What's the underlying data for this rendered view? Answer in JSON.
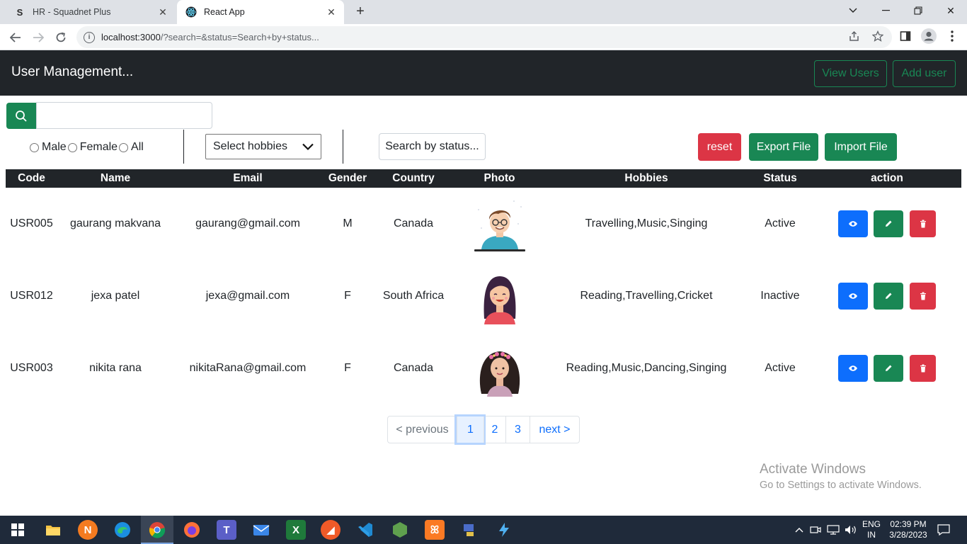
{
  "browser": {
    "tabs": [
      {
        "title": "HR - Squadnet Plus",
        "favicon": "S"
      },
      {
        "title": "React App",
        "favicon": "react-icon"
      }
    ],
    "url_main": "localhost:3000",
    "url_rest": "/?search=&status=Search+by+status..."
  },
  "app": {
    "brand": "User Management...",
    "nav": {
      "view_users": "View Users",
      "add_user": "Add user"
    }
  },
  "filters": {
    "search_value": "",
    "gender_options": [
      "Male",
      "Female",
      "All"
    ],
    "hobbies_select": "Select hobbies",
    "status_placeholder": "Search by status...",
    "reset": "reset",
    "export": "Export File",
    "import": "Import File"
  },
  "table": {
    "headers": [
      "Code",
      "Name",
      "Email",
      "Gender",
      "Country",
      "Photo",
      "Hobbies",
      "Status",
      "action"
    ],
    "rows": [
      {
        "code": "USR005",
        "name": "gaurang makvana",
        "email": "gaurang@gmail.com",
        "gender": "M",
        "country": "Canada",
        "hobbies": "Travelling,Music,Singing",
        "status": "Active"
      },
      {
        "code": "USR012",
        "name": "jexa patel",
        "email": "jexa@gmail.com",
        "gender": "F",
        "country": "South Africa",
        "hobbies": "Reading,Travelling,Cricket",
        "status": "Inactive"
      },
      {
        "code": "USR003",
        "name": "nikita rana",
        "email": "nikitaRana@gmail.com",
        "gender": "F",
        "country": "Canada",
        "hobbies": "Reading,Music,Dancing,Singing",
        "status": "Active"
      }
    ]
  },
  "pagination": {
    "previous": "< previous",
    "pages": [
      "1",
      "2",
      "3"
    ],
    "next": "next >",
    "current": "1"
  },
  "watermark": {
    "line1": "Activate Windows",
    "line2": "Go to Settings to activate Windows."
  },
  "taskbar": {
    "lang1": "ENG",
    "lang2": "IN",
    "time": "02:39 PM",
    "date": "3/28/2023"
  },
  "colors": {
    "primary": "#0d6efd",
    "success": "#198754",
    "danger": "#dc3545",
    "dark": "#212529"
  }
}
